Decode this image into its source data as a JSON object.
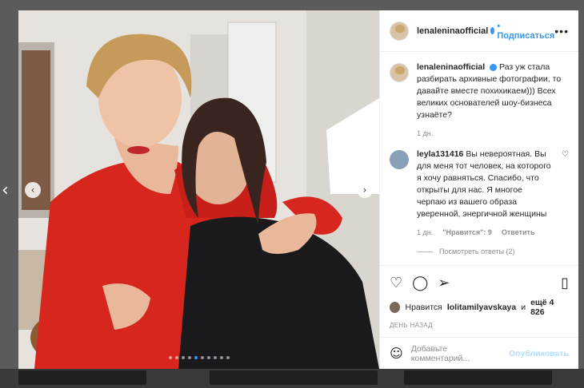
{
  "post": {
    "username": "lenaleninaofficial",
    "follow_label": "Подписаться",
    "more_label": "•••",
    "caption": {
      "username": "lenaleninaofficial",
      "text": "Раз уж стала разбирать архивные фотографии, то давайте вместе похихикаем))) Всех великих основателей шоу-бизнеса узнаёте?",
      "time": "1 дн."
    },
    "comments": [
      {
        "username": "leyla131416",
        "text": "Вы невероятная. Вы для меня тот человек, на которого я хочу равняться. Спасибо, что открыты для нас. Я многое черпаю из вашего образа уверенной, энергичной женщины",
        "time": "1 дн.",
        "likes": "\"Нравится\": 9",
        "reply_label": "Ответить",
        "view_replies": "Посмотреть ответы (2)"
      }
    ],
    "likes": {
      "prefix": "Нравится",
      "user": "lolitamilyavskaya",
      "suffix": "и",
      "count": "ещё 4 826"
    },
    "date": "ДЕНЬ НАЗАД",
    "add_comment_placeholder": "Добавьте комментарий...",
    "publish_label": "Опубликовать"
  },
  "icons": {
    "heart": "heart-icon",
    "comment": "comment-icon",
    "share": "share-icon",
    "bookmark": "bookmark-icon",
    "emoji": "emoji-icon"
  },
  "carousel": {
    "total": 10,
    "active_index": 4
  },
  "colors": {
    "accent": "#3897f0",
    "text": "#262626",
    "muted": "#8e8e8e"
  }
}
